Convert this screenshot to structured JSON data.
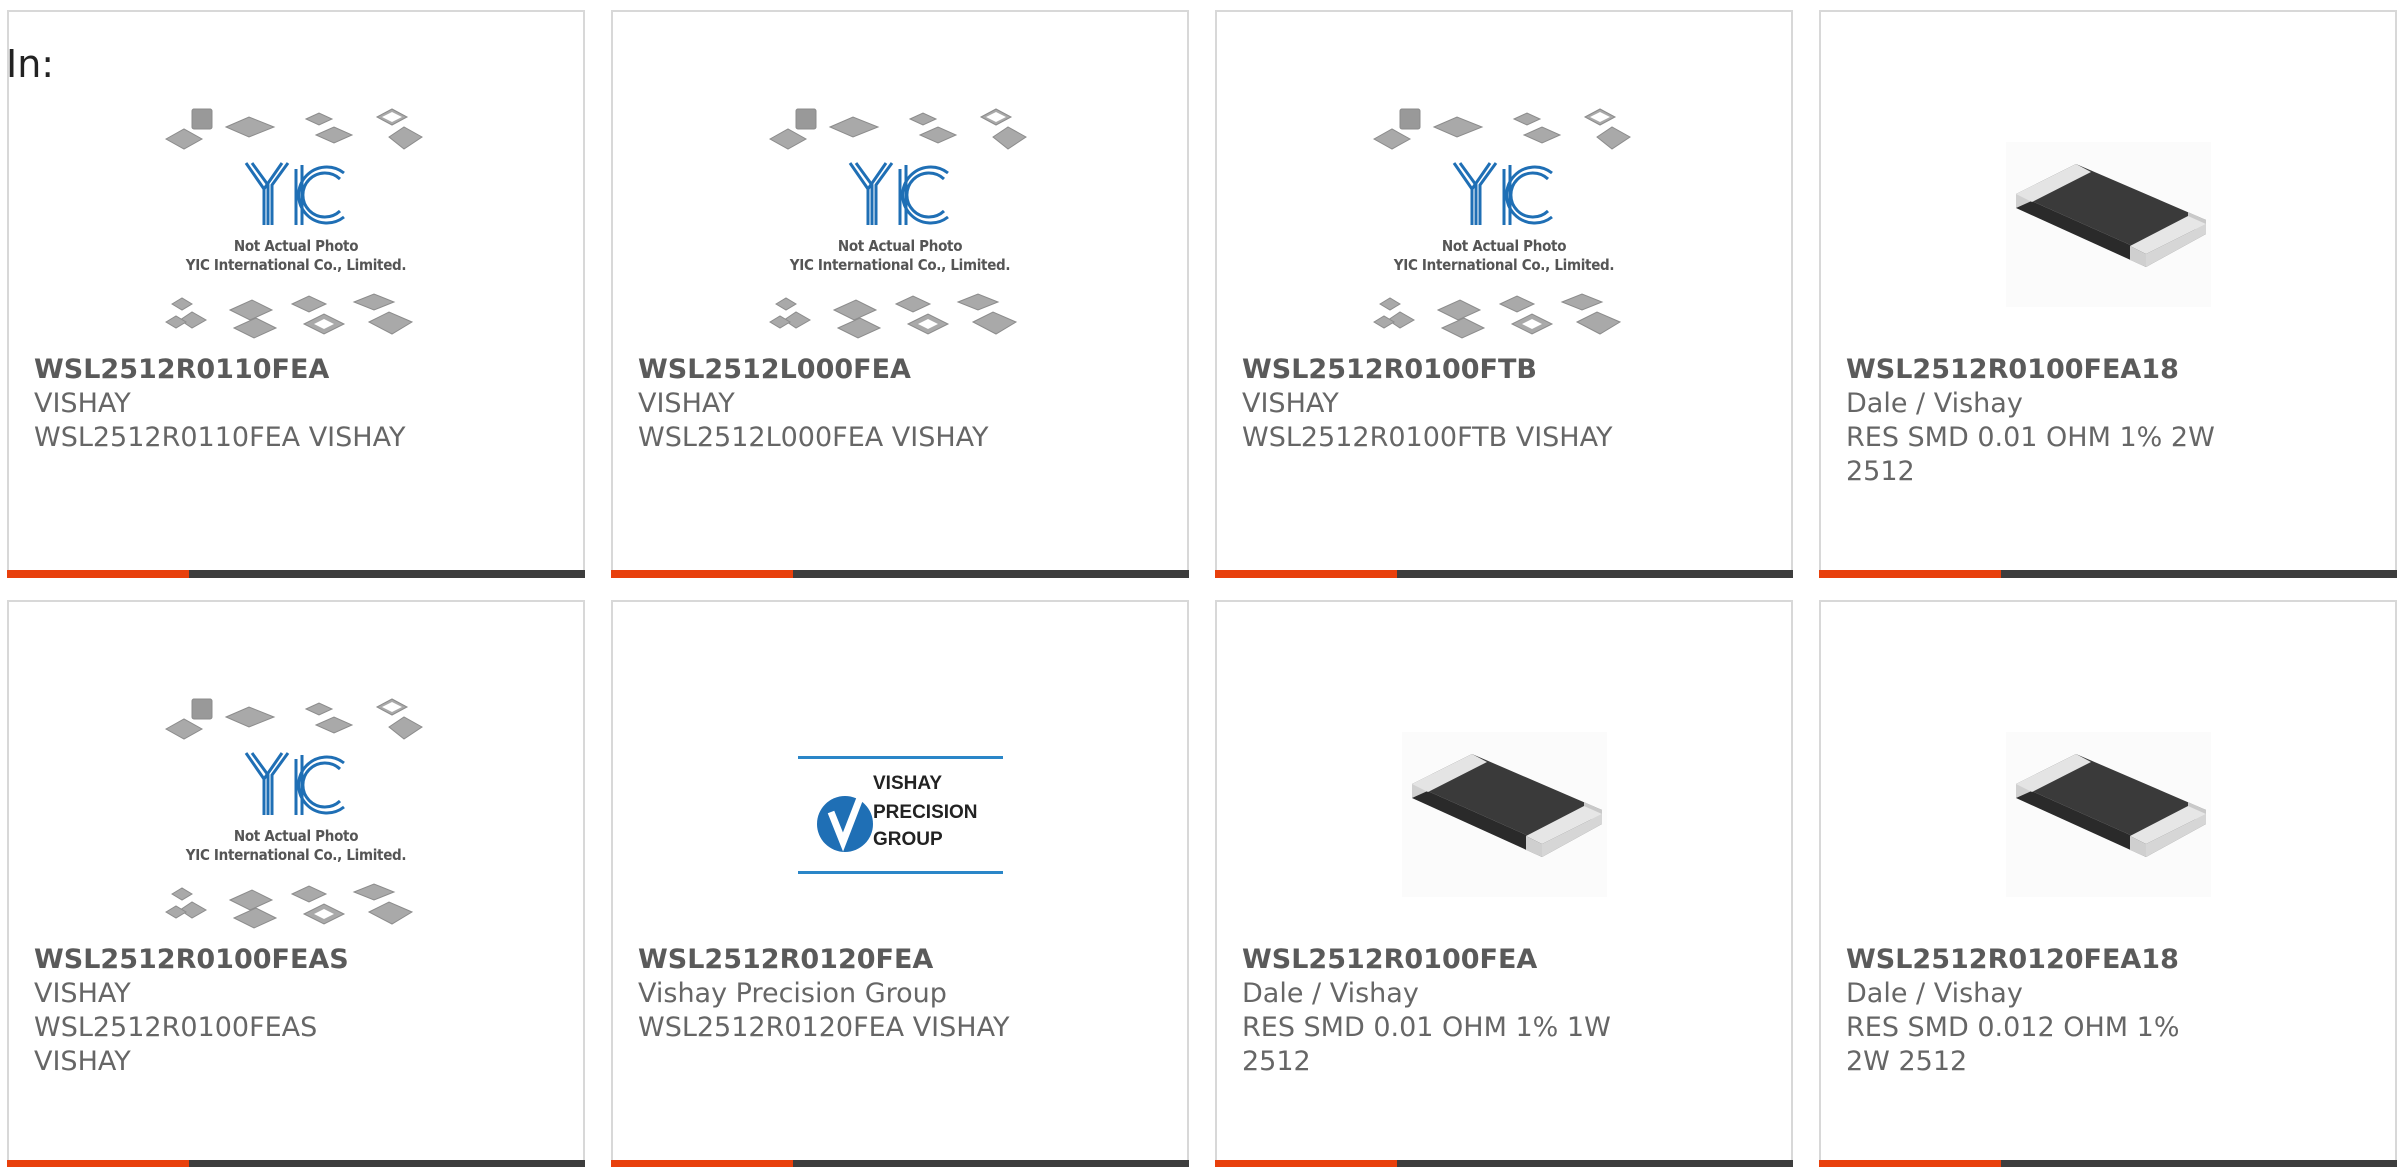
{
  "header": {
    "in_label": "In:"
  },
  "colors": {
    "accent": "#e8400c",
    "bar": "#3d3d3d",
    "card_border": "#d8d8d8",
    "text": "#666666",
    "yic_blue": "#1f6fb5"
  },
  "placeholder": {
    "line1": "Not Actual Photo",
    "line2": "YIC International Co., Limited."
  },
  "vpg_logo": {
    "line1": "VISHAY",
    "line2": "PRECISION",
    "line3": "GROUP"
  },
  "products": [
    {
      "part_number": "WSL2512R0110FEA",
      "manufacturer": "VISHAY",
      "description": "WSL2512R0110FEA VISHAY",
      "image": "yic-placeholder"
    },
    {
      "part_number": "WSL2512L000FEA",
      "manufacturer": "VISHAY",
      "description": "WSL2512L000FEA VISHAY",
      "image": "yic-placeholder"
    },
    {
      "part_number": "WSL2512R0100FTB",
      "manufacturer": "VISHAY",
      "description": "WSL2512R0100FTB VISHAY",
      "image": "yic-placeholder"
    },
    {
      "part_number": "WSL2512R0100FEA18",
      "manufacturer": "Dale / Vishay",
      "description": "RES SMD 0.01 OHM 1% 2W 2512",
      "image": "smd-resistor"
    },
    {
      "part_number": "WSL2512R0100FEAS",
      "manufacturer": "VISHAY",
      "description": "WSL2512R0100FEAS VISHAY",
      "image": "yic-placeholder"
    },
    {
      "part_number": "WSL2512R0120FEA",
      "manufacturer": "Vishay Precision Group",
      "description": "WSL2512R0120FEA VISHAY",
      "image": "vpg-logo"
    },
    {
      "part_number": "WSL2512R0100FEA",
      "manufacturer": "Dale / Vishay",
      "description": "RES SMD 0.01 OHM 1% 1W 2512",
      "image": "smd-resistor"
    },
    {
      "part_number": "WSL2512R0120FEA18",
      "manufacturer": "Dale / Vishay",
      "description": "RES SMD 0.012 OHM 1% 2W 2512",
      "image": "smd-resistor"
    }
  ]
}
